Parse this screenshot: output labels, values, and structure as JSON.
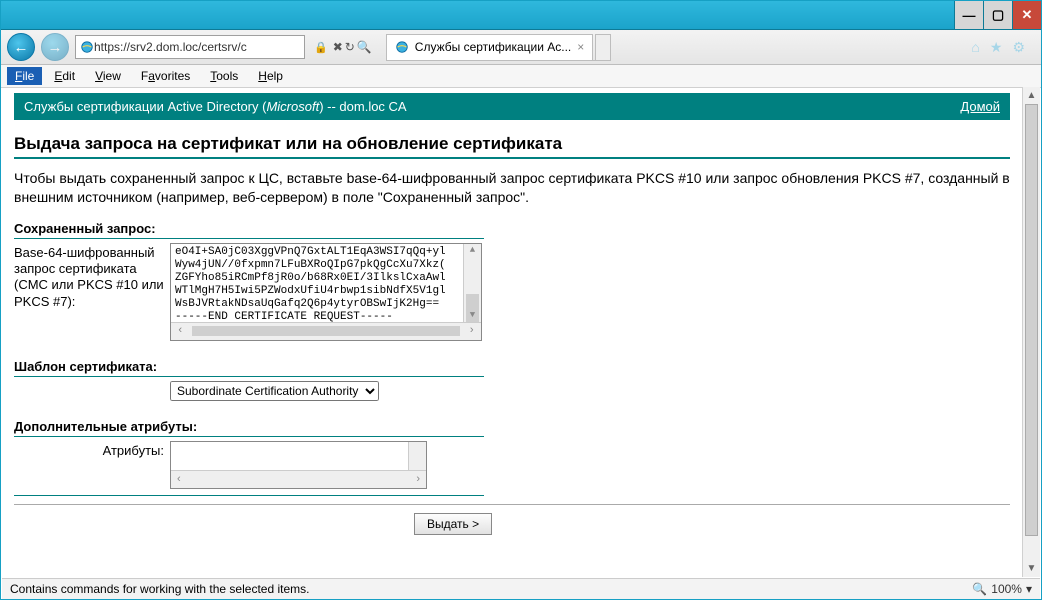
{
  "window": {
    "url": "https://srv2.dom.loc/certsrv/c",
    "tab_title": "Службы сертификации Ac...",
    "status_text": "Contains commands for working with the selected items.",
    "zoom": "100%"
  },
  "menu": {
    "file": "File",
    "edit": "Edit",
    "view": "View",
    "favorites": "Favorites",
    "tools": "Tools",
    "help": "Help"
  },
  "banner": {
    "prefix": "Службы сертификации Active Directory (",
    "brand_italic": "Microsoft",
    "suffix": ")  --  dom.loc CA",
    "home": "Домой"
  },
  "page": {
    "heading": "Выдача запроса на сертификат или на обновление сертификата",
    "intro": "Чтобы выдать сохраненный запрос к ЦС, вставьте base-64-шифрованный запрос сертификата PKCS #10 или запрос обновления PKCS #7, созданный в внешним источником (например, веб-сервером) в поле \"Сохраненный запрос\".",
    "saved_request_label": "Сохраненный запрос:",
    "req_field_label": "Base-64-шифрованный запрос сертификата (CMC или PKCS #10 или PKCS #7):",
    "req_value": "eO4I+SA0jC03XggVPnQ7GxtALT1EqA3WSI7qQq+yl\nWyw4jUN//0fxpmn7LFuBXRoQIpG7pkQgCcXu7Xkz(\nZGFYho85iRCmPf8jR0o/b68Rx0EI/3IlkslCxaAwl\nWTlMgH7H5Iwi5PZWodxUfiU4rbwp1sibNdfX5V1gl\nWsBJVRtakNDsaUqGafq2Q6p4ytyrOBSwIjK2Hg==\n-----END CERTIFICATE REQUEST-----",
    "template_label": "Шаблон сертификата:",
    "template_value": "Subordinate Certification Authority",
    "additional_label": "Дополнительные атрибуты:",
    "attributes_label": "Атрибуты:",
    "submit": "Выдать >"
  }
}
